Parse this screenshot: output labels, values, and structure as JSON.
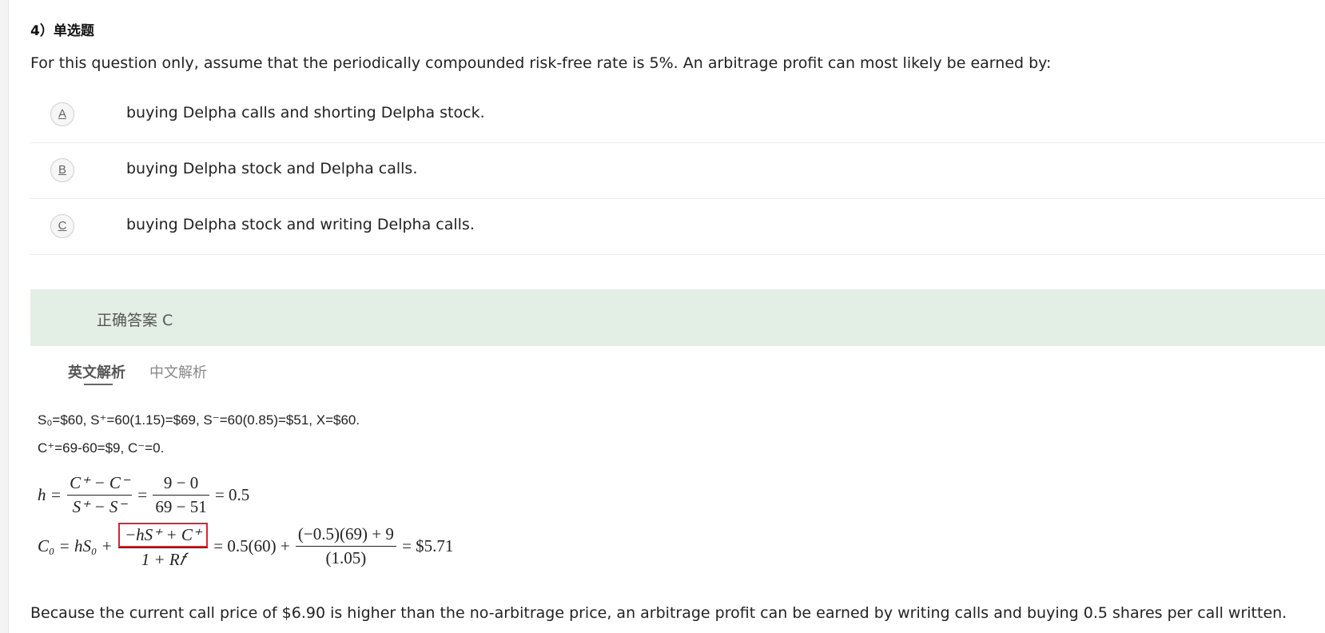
{
  "question": {
    "number": "4）单选题",
    "text": "For this question only, assume that the periodically compounded risk-free rate is 5%. An arbitrage profit can most likely be earned by:",
    "options": [
      {
        "letter": "A",
        "text": "buying Delpha calls and shorting Delpha stock."
      },
      {
        "letter": "B",
        "text": "buying Delpha stock and Delpha calls."
      },
      {
        "letter": "C",
        "text": "buying Delpha stock and writing Delpha calls."
      }
    ]
  },
  "answer": {
    "label": "正确答案 C"
  },
  "tabs": {
    "english": "英文解析",
    "chinese": "中文解析"
  },
  "explanation": {
    "line1": "S₀=$60, S⁺=60(1.15)=$69, S⁻=60(0.85)=$51, X=$60.",
    "line2": "C⁺=69-60=$9, C⁻=0.",
    "h_lhs": "h =",
    "h_num1": "C⁺ − C⁻",
    "h_den1": "S⁺ − S⁻",
    "h_eq": "=",
    "h_num2": "9 − 0",
    "h_den2": "69 − 51",
    "h_result": "= 0.5",
    "c_lhs": "C₀ = hS₀ +",
    "c_num1": "−hS⁺ + C⁺",
    "c_den1": "1 + R𝑓",
    "c_mid": "= 0.5(60) +",
    "c_num2": "(−0.5)(69) + 9",
    "c_den2": "(1.05)",
    "c_result": "= $5.71",
    "conclusion": "Because the current call price of $6.90 is higher than the no-arbitrage price, an arbitrage profit can be earned by writing calls and buying 0.5 shares per call written."
  },
  "colors": {
    "answer_bg": "#e3efe5",
    "highlight_box": "#d9262c"
  }
}
